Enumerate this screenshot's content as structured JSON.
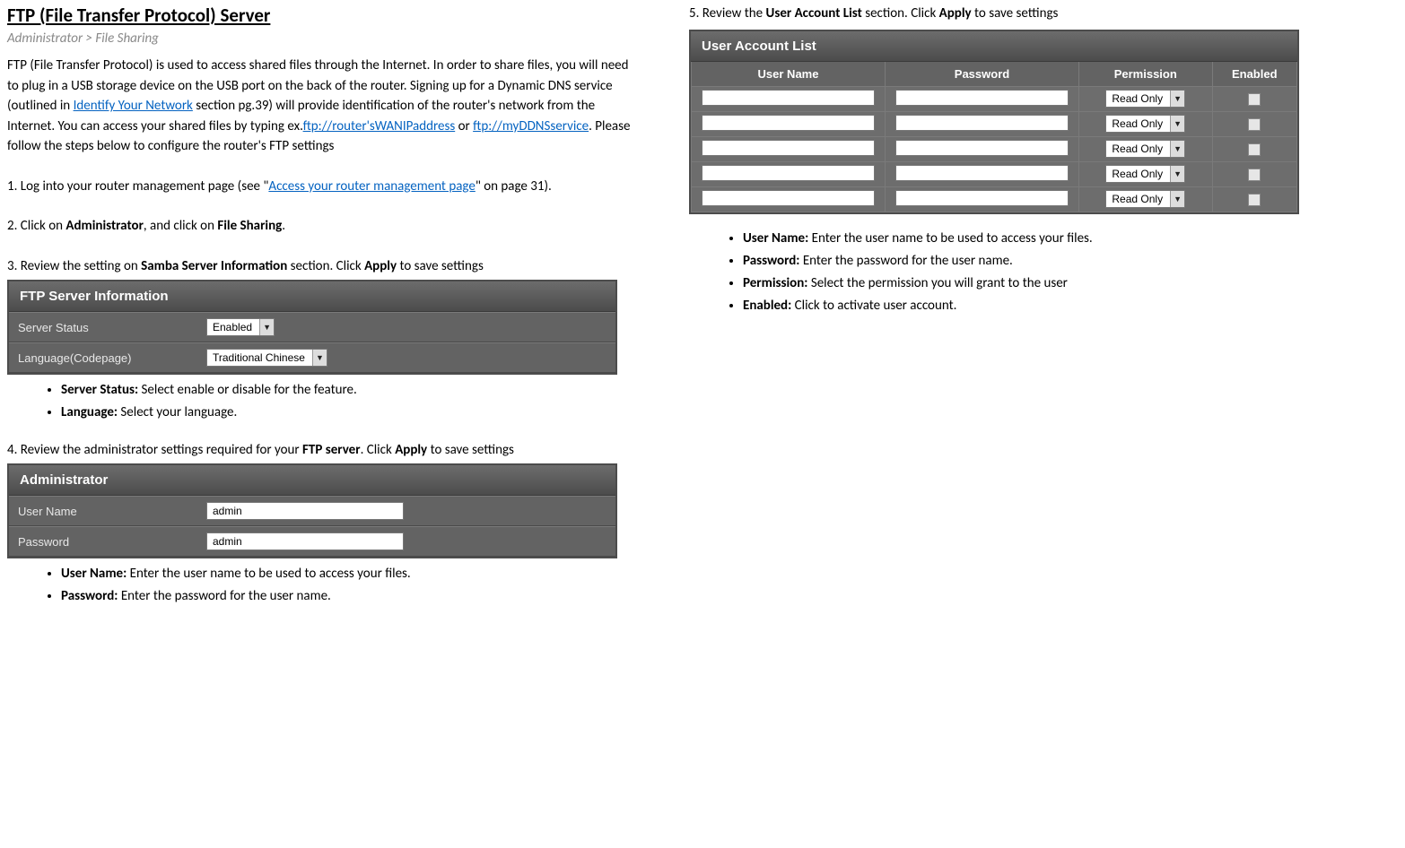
{
  "title": "FTP (File Transfer Protocol) Server",
  "breadcrumb": "Administrator > File Sharing",
  "intro": {
    "p1": "FTP (File Transfer Protocol) is used to access shared files through the Internet. In order to share files, you will need to plug in a USB storage device on the USB port on the back of the router. Signing up for a Dynamic DNS service (outlined in ",
    "link1": "Identify Your Network",
    "p2": " section pg.39) will provide identification of the router's network from the Internet. You can access your shared files by typing ex.",
    "link2": "ftp://router'sWANIPaddress",
    "p3": " or ",
    "link3": "ftp://myDDNSservice",
    "p4": ". Please follow the steps below to configure the router's FTP settings"
  },
  "steps": {
    "s1a": "1. Log into your router management page (see \"",
    "s1link": "Access your router management page",
    "s1b": "\" on page 31).",
    "s2a": "2. Click on ",
    "s2b": "Administrator",
    "s2c": ", and click on ",
    "s2d": "File Sharing",
    "s2e": ".",
    "s3a": "3. Review the setting on ",
    "s3b": "Samba Server Information",
    "s3c": " section. Click ",
    "s3d": "Apply",
    "s3e": " to save settings",
    "s4a": "4. Review the administrator settings required for your ",
    "s4b": "FTP server",
    "s4c": ". Click ",
    "s4d": "Apply",
    "s4e": " to save settings",
    "s5a": "5. Review the ",
    "s5b": "User Account List",
    "s5c": " section. Click ",
    "s5d": "Apply",
    "s5e": " to save settings"
  },
  "panel1": {
    "title": "FTP Server Information",
    "row1_label": "Server Status",
    "row1_value": "Enabled",
    "row2_label": "Language(Codepage)",
    "row2_value": "Traditional Chinese"
  },
  "bullets1": {
    "b1a": "Server Status:",
    "b1b": " Select enable or disable for the feature.",
    "b2a": "Language:",
    "b2b": " Select your language."
  },
  "panel2": {
    "title": "Administrator",
    "row1_label": "User Name",
    "row1_value": "admin",
    "row2_label": "Password",
    "row2_value": "admin"
  },
  "bullets2": {
    "b1a": "User Name:",
    "b1b": " Enter the user name to be used to access your files.",
    "b2a": "Password:",
    "b2b": " Enter the password for the user name."
  },
  "uaPanel": {
    "title": "User Account List",
    "headers": {
      "c1": "User Name",
      "c2": "Password",
      "c3": "Permission",
      "c4": "Enabled"
    },
    "permission_value": "Read Only",
    "row_count": 5
  },
  "bullets3": {
    "b1a": "User Name:",
    "b1b": " Enter the user name to be used to access your files.",
    "b2a": "Password:",
    "b2b": " Enter the password for the user name.",
    "b3a": "Permission:",
    "b3b": " Select the permission you will grant to the user",
    "b4a": "Enabled:",
    "b4b": " Click to activate user account."
  }
}
